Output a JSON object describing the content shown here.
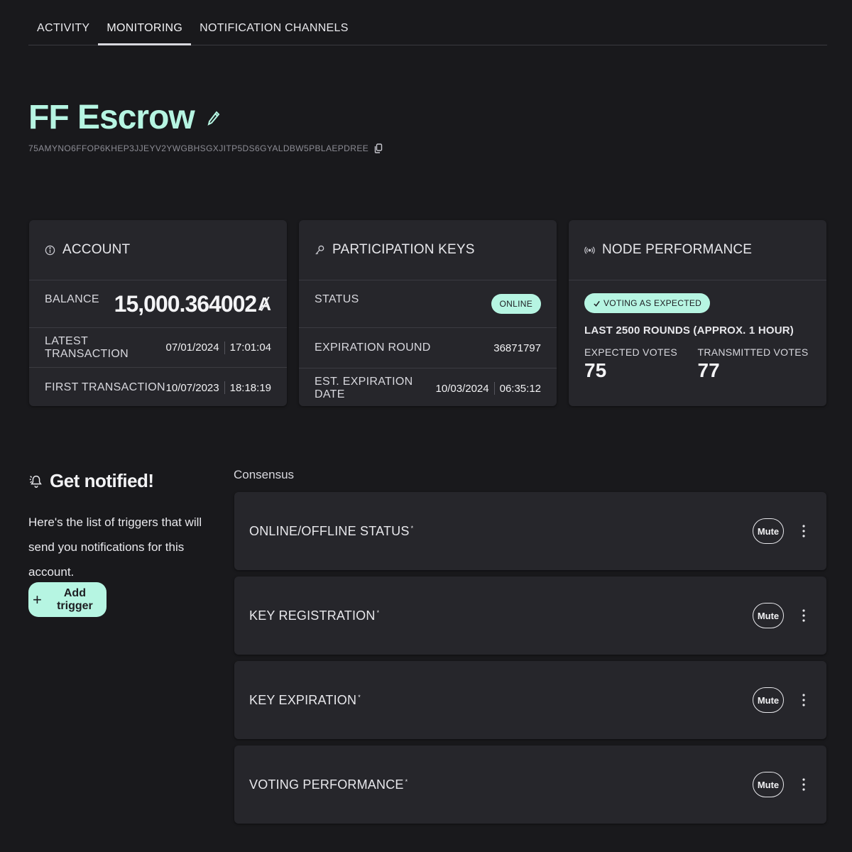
{
  "tabs": [
    {
      "label": "ACTIVITY"
    },
    {
      "label": "MONITORING"
    },
    {
      "label": "NOTIFICATION CHANNELS"
    }
  ],
  "active_tab": "MONITORING",
  "header": {
    "title": "FF Escrow",
    "address": "75AMYNO6FFOP6KHEP3JJEYV2YWGBHSGXJITP5DS6GYALDBW5PBLAEPDREE"
  },
  "account": {
    "title": "ACCOUNT",
    "balance_label": "BALANCE",
    "balance_value": "15,000.364002",
    "balance_unit": "Ⱥ",
    "latest_label": "LATEST TRANSACTION",
    "latest_date": "07/01/2024",
    "latest_time": "17:01:04",
    "first_label": "FIRST TRANSACTION",
    "first_date": "10/07/2023",
    "first_time": "18:18:19"
  },
  "participation": {
    "title": "PARTICIPATION KEYS",
    "status_label": "STATUS",
    "status_value": "ONLINE",
    "round_label": "EXPIRATION ROUND",
    "round_value": "36871797",
    "date_label": "EST. EXPIRATION DATE",
    "date_value": "10/03/2024",
    "time_value": "06:35:12"
  },
  "performance": {
    "title": "NODE PERFORMANCE",
    "badge": "VOTING AS EXPECTED",
    "rounds_label": "LAST 2500 ROUNDS (APPROX. 1 HOUR)",
    "expected_label": "EXPECTED VOTES",
    "expected_value": "75",
    "transmitted_label": "TRANSMITTED VOTES",
    "transmitted_value": "77"
  },
  "notify": {
    "title": "Get notified!",
    "description": "Here's the list of triggers that will send you notifications for this account.",
    "add_label": "Add trigger"
  },
  "consensus": {
    "label": "Consensus",
    "mute_label": "Mute",
    "triggers": [
      {
        "name": "ONLINE/OFFLINE STATUS"
      },
      {
        "name": "KEY REGISTRATION"
      },
      {
        "name": "KEY EXPIRATION"
      },
      {
        "name": "VOTING PERFORMANCE"
      }
    ]
  },
  "colors": {
    "background": "#19191c",
    "card": "#26262b",
    "accent": "#b6f5e2"
  }
}
